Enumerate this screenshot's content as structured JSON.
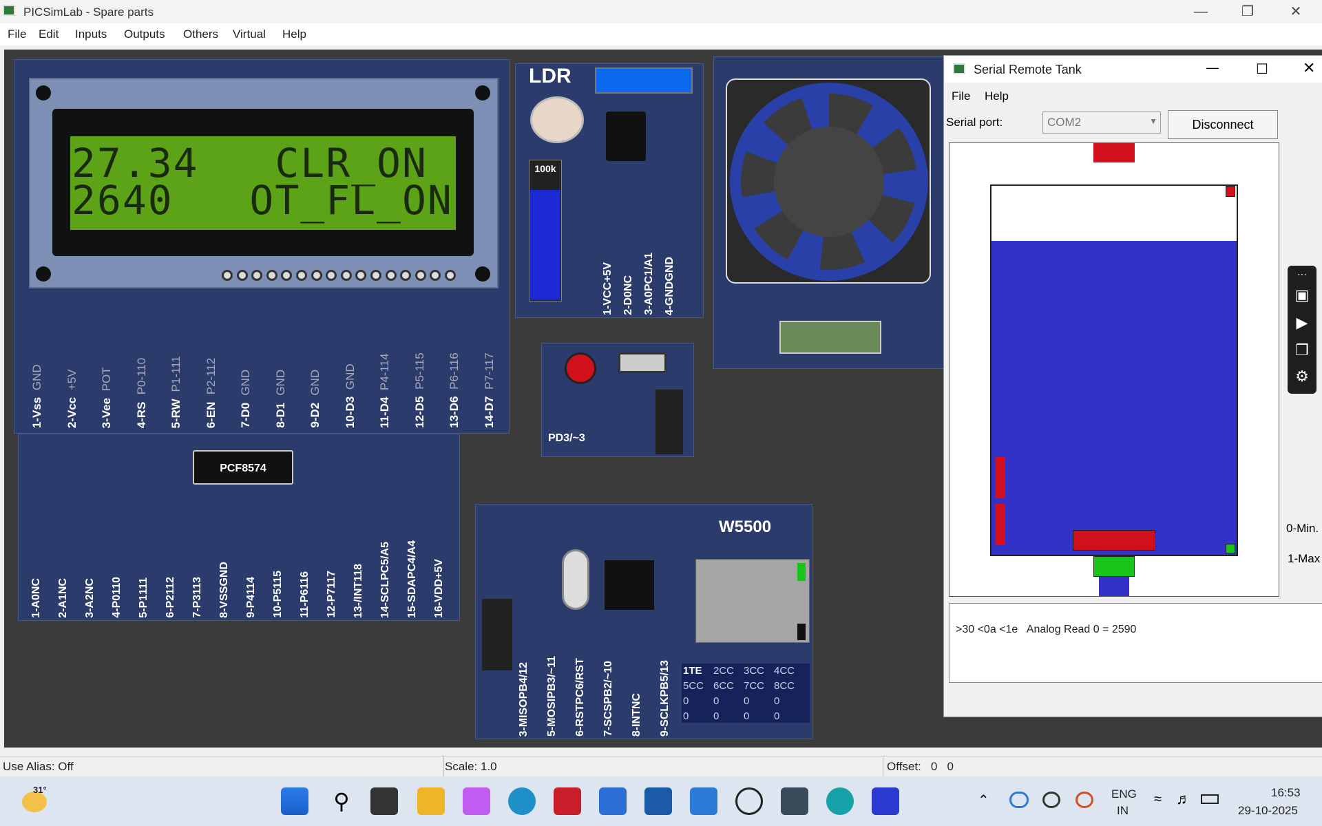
{
  "window": {
    "title": "PICSimLab - Spare parts"
  },
  "menu": [
    "File",
    "Edit",
    "Inputs",
    "Outputs",
    "Others",
    "Virtual",
    "Help"
  ],
  "lcd": {
    "line1": "27.34   CLR_ON",
    "line2": "2640   OT_FL_ON",
    "pins_top": [
      {
        "main": "1-Vss",
        "sub": "GND"
      },
      {
        "main": "2-Vcc",
        "sub": "+5V"
      },
      {
        "main": "3-Vee",
        "sub": "POT"
      },
      {
        "main": "4-RS",
        "sub": "P0-110"
      },
      {
        "main": "5-RW",
        "sub": "P1-111"
      },
      {
        "main": "6-EN",
        "sub": "P2-112"
      },
      {
        "main": "7-D0",
        "sub": "GND"
      },
      {
        "main": "8-D1",
        "sub": "GND"
      },
      {
        "main": "9-D2",
        "sub": "GND"
      },
      {
        "main": "10-D3",
        "sub": "GND"
      },
      {
        "main": "11-D4",
        "sub": "P4-114"
      },
      {
        "main": "12-D5",
        "sub": "P5-115"
      },
      {
        "main": "13-D6",
        "sub": "P6-116"
      },
      {
        "main": "14-D7",
        "sub": "P7-117"
      }
    ]
  },
  "pcf": {
    "chip": "PCF8574",
    "pins": [
      {
        "main": "1-A0",
        "sub": "NC"
      },
      {
        "main": "2-A1",
        "sub": "NC"
      },
      {
        "main": "3-A2",
        "sub": "NC"
      },
      {
        "main": "4-P0",
        "sub": "110"
      },
      {
        "main": "5-P1",
        "sub": "111"
      },
      {
        "main": "6-P2",
        "sub": "112"
      },
      {
        "main": "7-P3",
        "sub": "113"
      },
      {
        "main": "8-VSS",
        "sub": "GND"
      },
      {
        "main": "9-P4",
        "sub": "114"
      },
      {
        "main": "10-P5",
        "sub": "115"
      },
      {
        "main": "11-P6",
        "sub": "116"
      },
      {
        "main": "12-P7",
        "sub": "117"
      },
      {
        "main": "13-/INT",
        "sub": "118"
      },
      {
        "main": "14-SCL",
        "sub": "PC5/A5"
      },
      {
        "main": "15-SDA",
        "sub": "PC4/A4"
      },
      {
        "main": "16-VDD",
        "sub": "+5V"
      }
    ]
  },
  "ldr": {
    "title": "LDR",
    "pot_label": "100k",
    "pins": [
      {
        "main": "1-VCC",
        "sub": "+5V"
      },
      {
        "main": "2-D0",
        "sub": "NC"
      },
      {
        "main": "3-A0",
        "sub": "PC1/A1"
      },
      {
        "main": "4-GND",
        "sub": "GND"
      }
    ],
    "level": 0.9
  },
  "button_board": {
    "label": "PD3/~3"
  },
  "w5500": {
    "title": "W5500",
    "pins": [
      {
        "main": "3-MISO",
        "sub": "PB4/12"
      },
      {
        "main": "5-MOSI",
        "sub": "PB3/~11"
      },
      {
        "main": "6-RST",
        "sub": "PC6/RST"
      },
      {
        "main": "7-SCS",
        "sub": "PB2/~10"
      },
      {
        "main": "8-INT",
        "sub": "NC"
      },
      {
        "main": "9-SCLK",
        "sub": "PB5/13"
      }
    ],
    "table": [
      [
        "1TE",
        "2CC",
        "3CC",
        "4CC"
      ],
      [
        "5CC",
        "6CC",
        "7CC",
        "8CC"
      ],
      [
        "0",
        "0",
        "0",
        "0"
      ],
      [
        "0",
        "0",
        "0",
        "0"
      ]
    ]
  },
  "dialog": {
    "title": "Serial Remote Tank",
    "menu": [
      "File",
      "Help"
    ],
    "serial_label": "Serial port:",
    "port_value": "COM2",
    "disconnect": "Disconnect",
    "log": ">30 <0a <1e   Analog Read 0 = 2590",
    "water_level": 0.85,
    "side_labels": [
      "0-Min.",
      "1-Max"
    ]
  },
  "status": {
    "alias": "Use Alias: Off",
    "scale": "Scale: 1.0",
    "offset": "Offset:   0   0"
  },
  "taskbar": {
    "temp": "31°",
    "lang1": "ENG",
    "lang2": "IN",
    "time": "16:53",
    "date": "29-10-2025"
  },
  "colors": {
    "board": "#2b3b6b",
    "lcd_green": "#5da317",
    "water": "#3232c8",
    "red": "#d0101a",
    "green": "#19c419"
  }
}
